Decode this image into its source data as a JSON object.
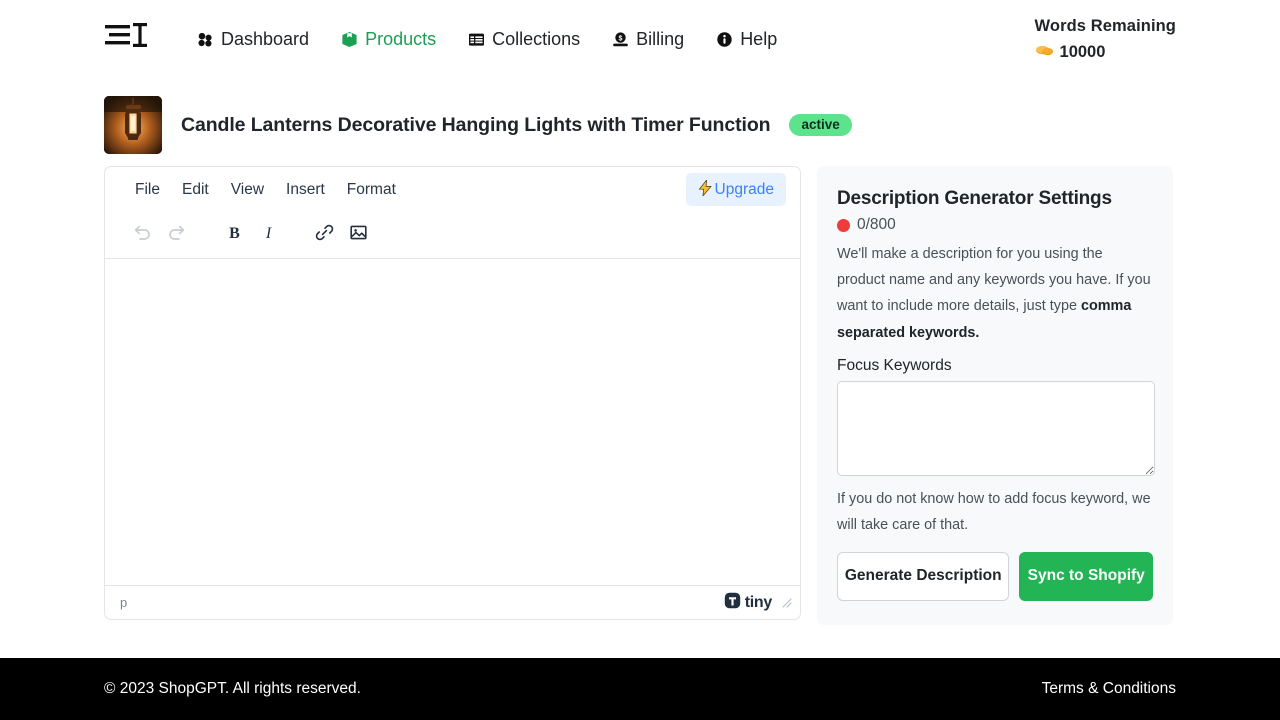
{
  "nav": {
    "logo_icon": "lines-and-text-cursor-logo",
    "links": [
      {
        "label": "Dashboard",
        "icon": "cubes-icon",
        "active": false
      },
      {
        "label": "Products",
        "icon": "box-icon",
        "active": true
      },
      {
        "label": "Collections",
        "icon": "table-list-icon",
        "active": false
      },
      {
        "label": "Billing",
        "icon": "money-bill-icon",
        "active": false
      },
      {
        "label": "Help",
        "icon": "info-circle-icon",
        "active": false
      }
    ],
    "words_remaining_label": "Words Remaining",
    "words_remaining_value": "10000",
    "words_icon": "coins-icon"
  },
  "product": {
    "thumbnail_icon": "lantern-photo-thumbnail",
    "title": "Candle Lanterns Decorative Hanging Lights with Timer Function",
    "status_badge": "active",
    "status_color": "#5ce38b"
  },
  "editor": {
    "menu": [
      "File",
      "Edit",
      "View",
      "Insert",
      "Format"
    ],
    "upgrade_label": "Upgrade",
    "upgrade_icon": "lightning-bolt-icon",
    "upgrade_color": "#3b82f6",
    "toolbar": [
      {
        "name": "undo-icon",
        "disabled": true
      },
      {
        "name": "redo-icon",
        "disabled": true
      },
      {
        "name": "bold-icon",
        "disabled": false
      },
      {
        "name": "italic-icon",
        "disabled": false
      },
      {
        "name": "link-icon",
        "disabled": false
      },
      {
        "name": "image-icon",
        "disabled": false
      }
    ],
    "body_content": "",
    "status_path": "p",
    "brand_label": "tiny",
    "brand_icon": "tinymce-logo-icon"
  },
  "settings": {
    "title": "Description Generator Settings",
    "counter": "0/800",
    "counter_dot_color": "#f03b3b",
    "description_part1": "We'll make a description for you using the product name and any keywords you have. If you want to include more details, just type ",
    "description_bold": "comma separated keywords.",
    "keywords_label": "Focus Keywords",
    "keywords_value": "",
    "keywords_placeholder": "",
    "hint": "If you do not know how to add focus keyword, we will take care of that.",
    "generate_label": "Generate Description",
    "sync_label": "Sync to Shopify",
    "sync_color": "#22b455"
  },
  "footer": {
    "copyright": "© 2023 ShopGPT. All rights reserved.",
    "terms": "Terms & Conditions"
  }
}
